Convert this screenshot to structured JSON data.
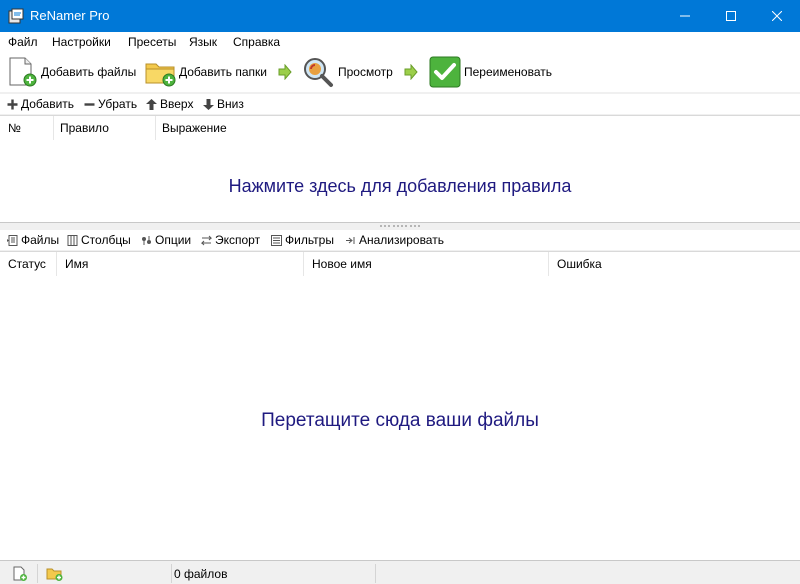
{
  "window": {
    "title": "ReNamer Pro"
  },
  "menu": [
    "Файл",
    "Настройки",
    "Пресеты",
    "Язык",
    "Справка"
  ],
  "toolbar": {
    "add_files": "Добавить файлы",
    "add_folders": "Добавить папки",
    "preview": "Просмотр",
    "rename": "Переименовать"
  },
  "rules_toolbar": {
    "add": "Добавить",
    "remove": "Убрать",
    "up": "Вверх",
    "down": "Вниз"
  },
  "rules_table": {
    "columns": [
      "№",
      "Правило",
      "Выражение"
    ],
    "hint": "Нажмите здесь для добавления правила"
  },
  "files_toolbar": {
    "files": "Файлы",
    "columns": "Столбцы",
    "options": "Опции",
    "export": "Экспорт",
    "filters": "Фильтры",
    "analyze": "Анализировать"
  },
  "files_table": {
    "columns": [
      "Статус",
      "Имя",
      "Новое имя",
      "Ошибка"
    ],
    "hint": "Перетащите сюда ваши файлы"
  },
  "statusbar": {
    "file_count": "0 файлов"
  },
  "colors": {
    "titlebar": "#0078d7",
    "hint_text": "#1f1a80",
    "accent_green": "#4db33d"
  }
}
